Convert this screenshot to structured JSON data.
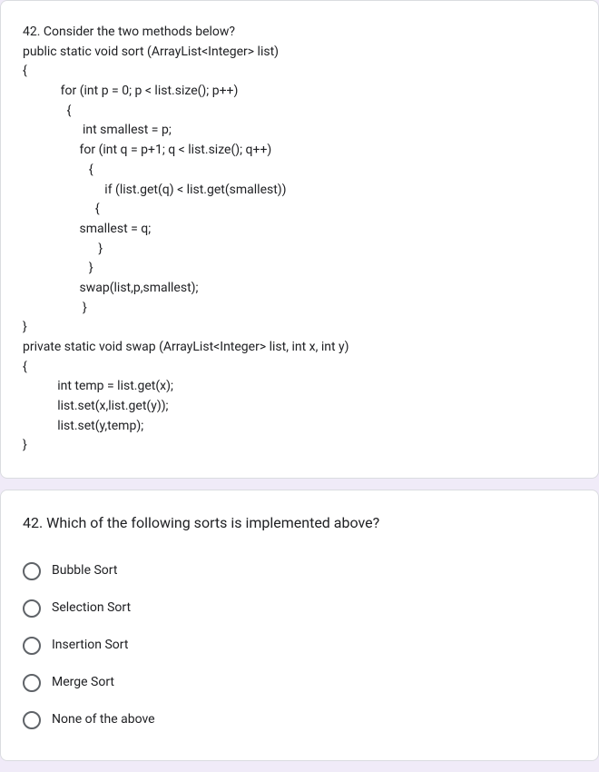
{
  "code_block": "42. Consider the two methods below?\npublic static void sort (ArrayList<Integer> list)\n{\n            for (int p = 0; p < list.size(); p++)\n              {\n                   int smallest = p;\n                  for (int q = p+1; q < list.size(); q++)\n                     {\n                          if (list.get(q) < list.get(smallest))\n                       {\n                  smallest = q;\n                        }\n                     }\n                  swap(list,p,smallest);\n                   }\n}\nprivate static void swap (ArrayList<Integer> list, int x, int y)\n{\n           int temp = list.get(x);\n           list.set(x,list.get(y));\n           list.set(y,temp);\n}",
  "question": "42. Which of the following sorts is implemented above?",
  "options": [
    "Bubble Sort",
    "Selection Sort",
    "Insertion Sort",
    "Merge Sort",
    "None of the above"
  ]
}
